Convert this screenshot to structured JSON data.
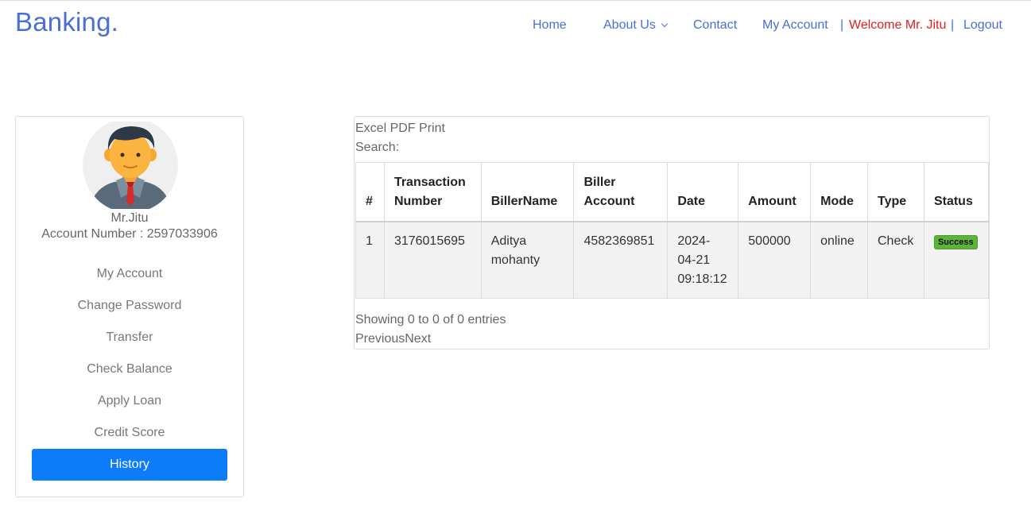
{
  "brand": "Banking.",
  "nav": {
    "home": "Home",
    "about": "About Us",
    "contact": "Contact",
    "my_account": "My Account",
    "separator": "|",
    "welcome": "Welcome Mr. Jitu",
    "logout": "Logout"
  },
  "sidebar": {
    "avatar_icon": "businessman-avatar-icon",
    "name": "Mr.Jitu",
    "account_number": "Account Number : 2597033906",
    "items": [
      {
        "label": "My Account"
      },
      {
        "label": "Change Password"
      },
      {
        "label": "Transfer"
      },
      {
        "label": "Check Balance"
      },
      {
        "label": "Apply Loan"
      },
      {
        "label": "Credit Score"
      },
      {
        "label": "History",
        "active": true
      }
    ],
    "active_color": "#0d7cf9"
  },
  "toolbar": {
    "excel": "Excel",
    "pdf": "PDF",
    "print": "Print"
  },
  "search_label": "Search:",
  "table": {
    "headers": [
      "#",
      "Transaction Number",
      "BillerName",
      "Biller Account",
      "Date",
      "Amount",
      "Mode",
      "Type",
      "Status"
    ],
    "rows": [
      {
        "index": "1",
        "transaction_number": "3176015695",
        "biller_name": "Aditya mohanty",
        "biller_account": "4582369851",
        "date": "2024-04-21 09:18:12",
        "amount": "500000",
        "mode": "online",
        "type": "Check",
        "status": "Success"
      }
    ]
  },
  "footer": {
    "showing": "Showing 0 to 0 of 0 entries",
    "previous": "Previous",
    "next": "Next"
  },
  "colors": {
    "brand": "#4a6fd4",
    "welcome": "#e02020",
    "success": "#5cb43a"
  }
}
